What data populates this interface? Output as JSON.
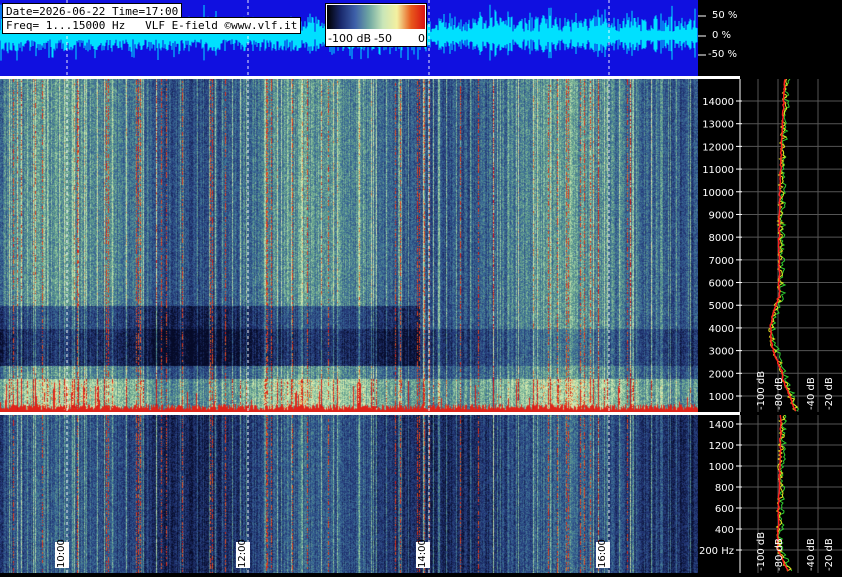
{
  "header": {
    "line1": "Date=2026-06-22 Time=17:00",
    "line2": "Freq= 1...15000 Hz   VLF E-field ©www.vlf.it"
  },
  "colorbar": {
    "ticks": [
      "-100 dB",
      "-50",
      "0"
    ],
    "stops": [
      "#000000",
      "#1a2a6e",
      "#3d5fa8",
      "#6fa7a2",
      "#c9e6b8",
      "#f4f0a0",
      "#e85a1c",
      "#d81010"
    ]
  },
  "waveform": {
    "labels": [
      "50 %",
      "0 %",
      "-50 %"
    ],
    "background": "#1010e0",
    "trace_color": "#00e0ff"
  },
  "time_axis": {
    "labels": [
      "10:00",
      "12:00",
      "14:00",
      "16:00"
    ]
  },
  "upper_panel": {
    "freq_labels": [
      "14000",
      "13000",
      "12000",
      "11000",
      "10000",
      "9000",
      "8000",
      "7000",
      "6000",
      "5000",
      "4000",
      "3000",
      "2000",
      "1000"
    ],
    "db_labels": [
      "-100 dB",
      "-80 dB",
      "-40 dB",
      "-20 dB"
    ]
  },
  "lower_panel": {
    "freq_labels": [
      "1400",
      "1200",
      "1000",
      "800",
      "600",
      "400",
      "200 Hz"
    ],
    "db_labels": [
      "-100 dB",
      "-80 dB",
      "-40 dB",
      "-20 dB"
    ]
  },
  "colors": {
    "spectrum_trace_red": "#ff2020",
    "spectrum_trace_yellow": "#e8e020",
    "spectrum_trace_green": "#30d030"
  }
}
